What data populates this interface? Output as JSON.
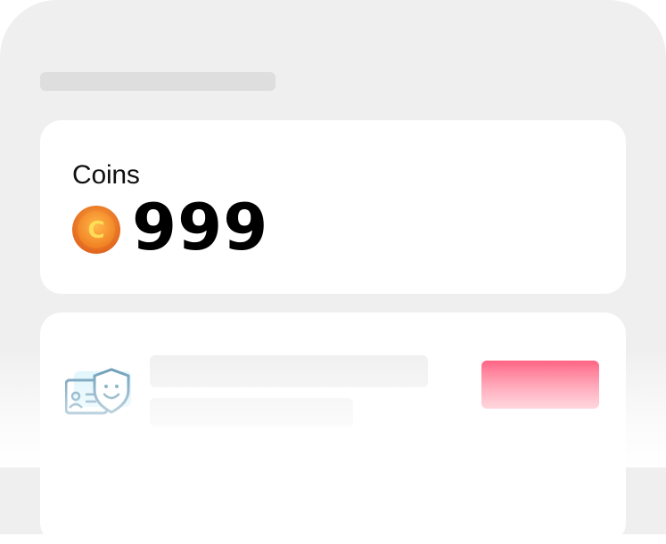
{
  "coins": {
    "label": "Coins",
    "amount": "999",
    "icon": "coin-icon",
    "icon_letter": "C"
  },
  "task": {
    "icon": "id-card-shield-icon",
    "button_label": ""
  },
  "colors": {
    "background": "#efefef",
    "card": "#ffffff",
    "accent_button_top": "#ff4d72",
    "accent_button_bottom": "#ff9bad",
    "coin_orange": "#f08a2c",
    "coin_yellow": "#ffd24a",
    "icon_blue": "#4a86a8"
  }
}
